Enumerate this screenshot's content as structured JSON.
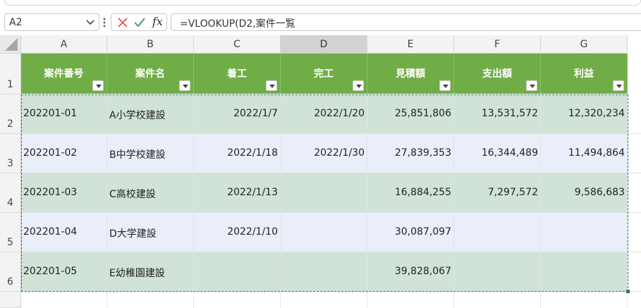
{
  "formula_bar": {
    "name_box": "A2",
    "formula": "=VLOOKUP(D2,案件一覧",
    "fx_label": "fx"
  },
  "columns": [
    "A",
    "B",
    "C",
    "D",
    "E",
    "F",
    "G"
  ],
  "selected_column": "D",
  "rows": [
    "1",
    "2",
    "3",
    "4",
    "5",
    "6"
  ],
  "table": {
    "headers": [
      "案件番号",
      "案件名",
      "着工",
      "完工",
      "見積額",
      "支出額",
      "利益"
    ],
    "data": [
      [
        "202201-01",
        "A小学校建設",
        "2022/1/7",
        "2022/1/20",
        "25,851,806",
        "13,531,572",
        "12,320,234"
      ],
      [
        "202201-02",
        "B中学校建設",
        "2022/1/18",
        "2022/1/30",
        "27,839,353",
        "16,344,489",
        "11,494,864"
      ],
      [
        "202201-03",
        "C高校建設",
        "2022/1/13",
        "",
        "16,884,255",
        "7,297,572",
        "9,586,683"
      ],
      [
        "202201-04",
        "D大学建設",
        "2022/1/10",
        "",
        "30,087,097",
        "",
        ""
      ],
      [
        "202201-05",
        "E幼稚園建設",
        "",
        "",
        "39,828,067",
        "",
        ""
      ]
    ]
  },
  "colors": {
    "header_green": "#70ad47",
    "band_green": "#d0e3d6",
    "band_blue": "#e9eef9",
    "cancel_red": "#e05252",
    "confirm_green": "#3c9a5f"
  }
}
